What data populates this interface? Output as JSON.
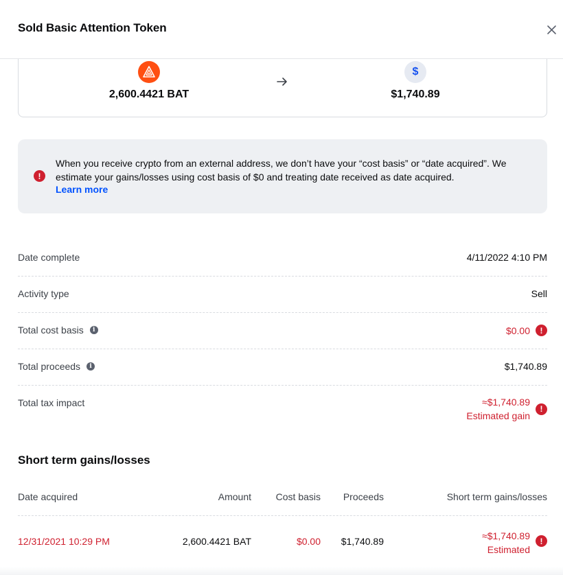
{
  "header": {
    "title": "Sold Basic Attention Token",
    "close_icon": "close-icon"
  },
  "conversion": {
    "from": {
      "icon": "bat-token-icon",
      "amount": "2,600.4421 BAT",
      "color": "#ff4f12"
    },
    "to": {
      "icon": "dollar-icon",
      "symbol": "$",
      "amount": "$1,740.89"
    }
  },
  "notice": {
    "text": "When you receive crypto from an external address, we don’t have your “cost basis” or “date acquired”. We estimate your gains/losses using cost basis of $0 and treating date received as date acquired.",
    "link": "Learn more",
    "alert_symbol": "!"
  },
  "details": [
    {
      "label": "Date complete",
      "value": "4/11/2022 4:10 PM"
    },
    {
      "label": "Activity type",
      "value": "Sell"
    },
    {
      "label": "Total cost basis",
      "value": "$0.00",
      "info": "i"
    },
    {
      "label": "Total proceeds",
      "value": "$1,740.89",
      "info": "i"
    },
    {
      "label": "Total tax impact",
      "value": "≈$1,740.89",
      "sub": "Estimated gain"
    }
  ],
  "short_term": {
    "title": "Short term gains/losses",
    "columns": [
      "Date acquired",
      "Amount",
      "Cost basis",
      "Proceeds",
      "Short term gains/losses"
    ],
    "rows": [
      {
        "date": "12/31/2021 10:29 PM",
        "amount": "2,600.4421 BAT",
        "cost_basis": "$0.00",
        "proceeds": "$1,740.89",
        "gain": "≈$1,740.89",
        "gain_sub": "Estimated"
      }
    ]
  },
  "colors": {
    "accent": "#0052ff",
    "negative": "#cf202f",
    "notice_bg": "#eef0f3"
  }
}
